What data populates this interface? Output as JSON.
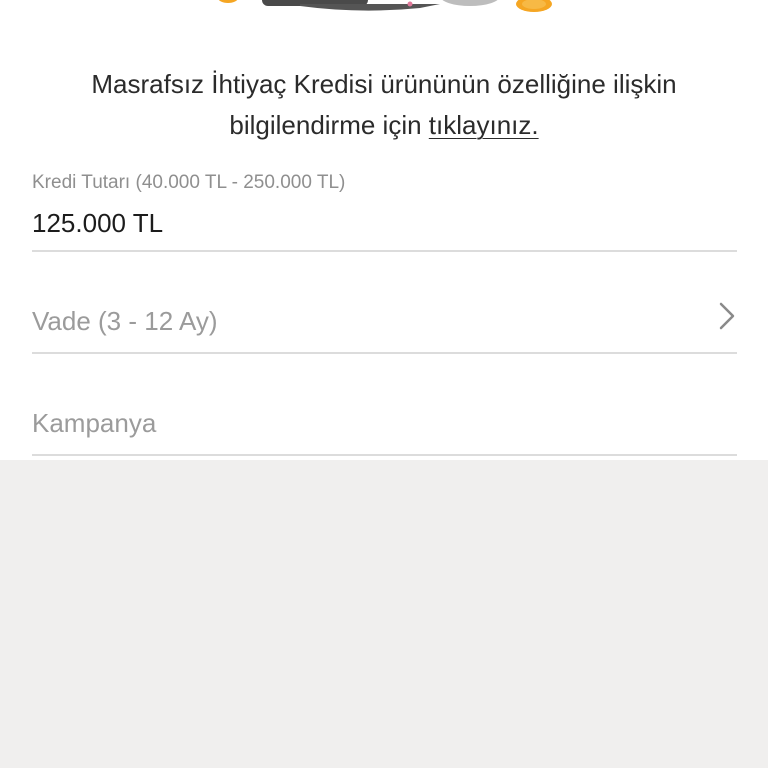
{
  "info": {
    "text_part1": "Masrafsız İhtiyaç Kredisi ürününün özelliğine ilişkin bilgilendirme için ",
    "link_text": "tıklayınız."
  },
  "amount_field": {
    "label": "Kredi Tutarı (40.000 TL - 250.000 TL)",
    "value": "125.000 TL"
  },
  "term_field": {
    "placeholder": "Vade (3 - 12 Ay)",
    "icon": "chevron-right-icon"
  },
  "campaign_field": {
    "placeholder": "Kampanya"
  },
  "colors": {
    "background": "#f0efee",
    "sheet": "#ffffff",
    "illustration_orange": "#f5a623"
  }
}
